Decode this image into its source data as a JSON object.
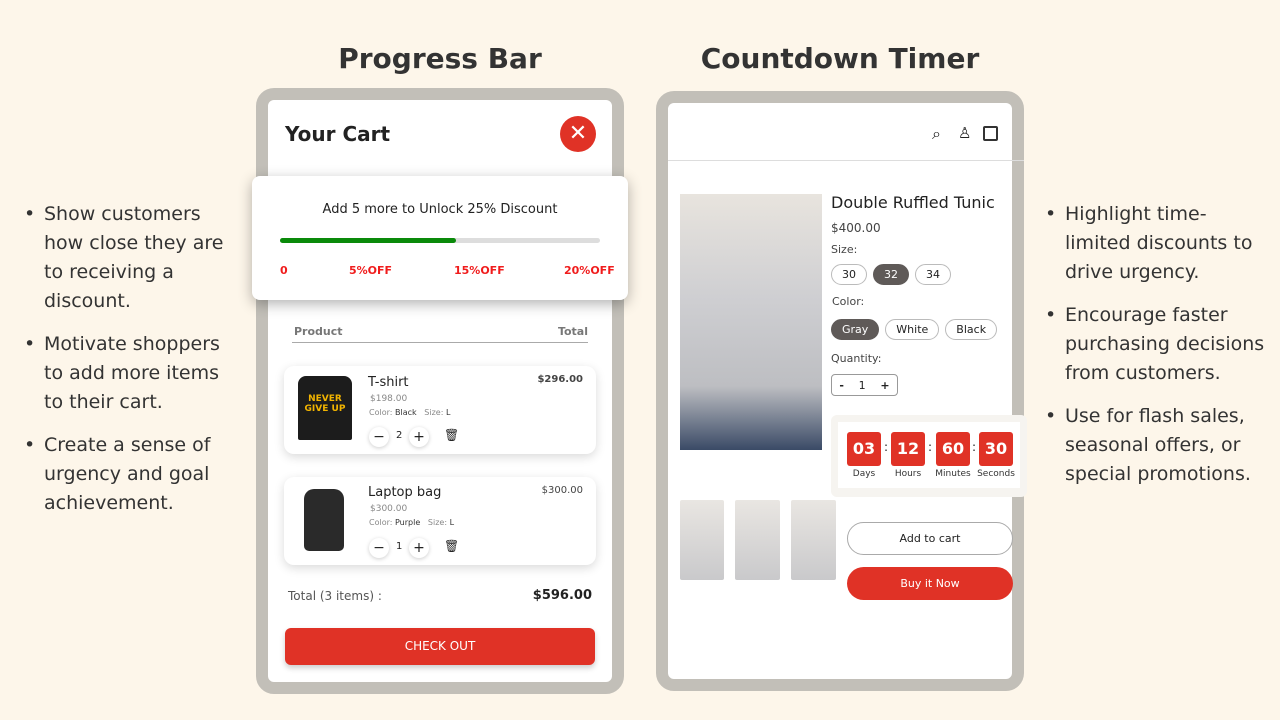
{
  "headings": {
    "left": "Progress Bar",
    "right": "Countdown Timer"
  },
  "left_bullets": [
    "Show customers how close they are to receiving a discount.",
    "Motivate shoppers to add more items to their cart.",
    "Create a sense of urgency and goal achievement."
  ],
  "right_bullets": [
    "Highlight time-limited discounts to drive urgency.",
    "Encourage faster purchasing decisions from customers.",
    "Use for flash sales, seasonal offers, or special promotions."
  ],
  "cart": {
    "title": "Your Cart",
    "progress": {
      "message": "Add 5 more to Unlock 25% Discount",
      "fill_percent": 55,
      "milestones": [
        "0",
        "5%OFF",
        "15%OFF",
        "20%OFF"
      ],
      "fill_color": "#0a8a0a"
    },
    "col_product": "Product",
    "col_total": "Total",
    "items": [
      {
        "name": "T-shirt",
        "price": "$198.00",
        "color_label": "Color:",
        "color": "Black",
        "size_label": "Size:",
        "size": "L",
        "qty": "2",
        "total": "$296.00",
        "image_text": "NEVER GIVE UP"
      },
      {
        "name": "Laptop bag",
        "price": "$300.00",
        "color_label": "Color:",
        "color": "Purple",
        "size_label": "Size:",
        "size": "L",
        "qty": "1",
        "total": "$300.00"
      }
    ],
    "total_label": "Total (3 items) :",
    "total_value": "$596.00",
    "checkout": "CHECK OUT",
    "accent": "#e03226"
  },
  "product": {
    "name": "Double Ruffled Tunic",
    "price": "$400.00",
    "size_label": "Size:",
    "sizes": [
      "30",
      "32",
      "34"
    ],
    "selected_size": "32",
    "color_label": "Color:",
    "colors": [
      "Gray",
      "White",
      "Black"
    ],
    "selected_color": "Gray",
    "qty_label": "Quantity:",
    "qty": "1",
    "minus": "-",
    "plus": "+",
    "timer": {
      "days": "03",
      "hours": "12",
      "minutes": "60",
      "seconds": "30",
      "days_label": "Days",
      "hours_label": "Hours",
      "minutes_label": "Minutes",
      "seconds_label": "Seconds"
    },
    "add_to_cart": "Add to cart",
    "buy_now": "Buy it Now"
  }
}
